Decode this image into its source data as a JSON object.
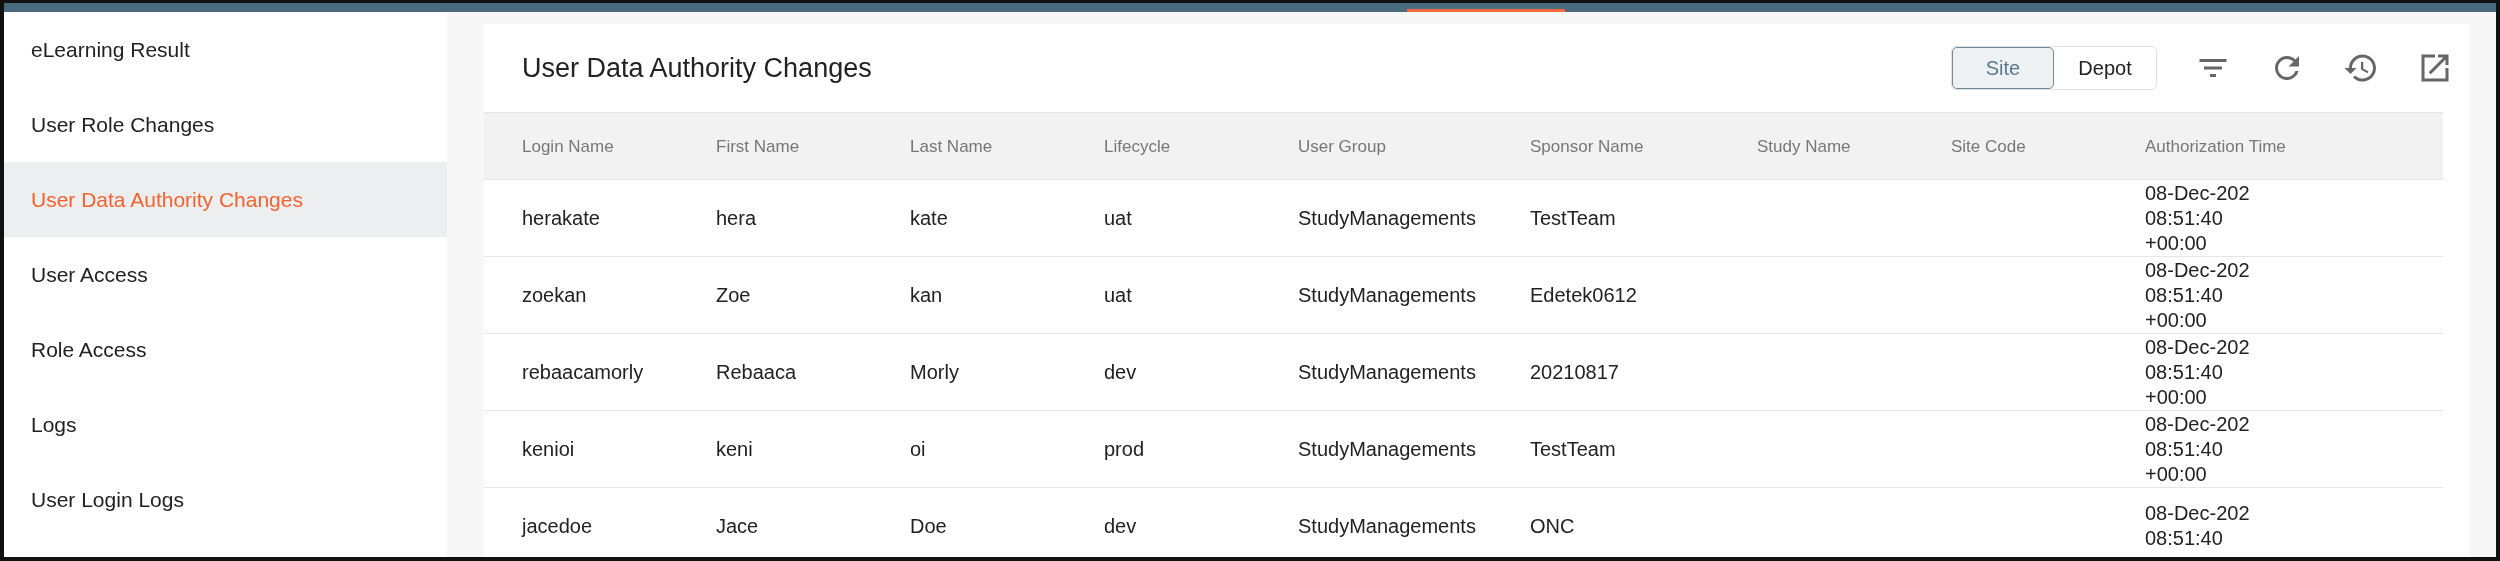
{
  "sidebar": {
    "items": [
      {
        "label": "eLearning Result",
        "selected": false
      },
      {
        "label": "User Role Changes",
        "selected": false
      },
      {
        "label": "User Data Authority Changes",
        "selected": true
      },
      {
        "label": "User Access",
        "selected": false
      },
      {
        "label": "Role Access",
        "selected": false
      },
      {
        "label": "Logs",
        "selected": false
      },
      {
        "label": "User Login Logs",
        "selected": false
      }
    ]
  },
  "panel": {
    "title": "User Data Authority Changes",
    "toggle": [
      {
        "label": "Site",
        "selected": true
      },
      {
        "label": "Depot",
        "selected": false
      }
    ],
    "table": {
      "columns": [
        "Login Name",
        "First Name",
        "Last Name",
        "Lifecycle",
        "User Group",
        "Sponsor Name",
        "Study Name",
        "Site Code",
        "Authorization Time"
      ],
      "rows": [
        {
          "cells": [
            "herakate",
            "hera",
            "kate",
            "uat",
            "StudyManagements",
            "TestTeam",
            "",
            ""
          ],
          "time": [
            "08-Dec-202",
            "08:51:40",
            "+00:00"
          ]
        },
        {
          "cells": [
            "zoekan",
            "Zoe",
            "kan",
            "uat",
            "StudyManagements",
            "Edetek0612",
            "",
            ""
          ],
          "time": [
            "08-Dec-202",
            "08:51:40",
            "+00:00"
          ]
        },
        {
          "cells": [
            "rebaacamorly",
            "Rebaaca",
            "Morly",
            "dev",
            "StudyManagements",
            "20210817",
            "",
            ""
          ],
          "time": [
            "08-Dec-202",
            "08:51:40",
            "+00:00"
          ]
        },
        {
          "cells": [
            "kenioi",
            "keni",
            "oi",
            "prod",
            "StudyManagements",
            "TestTeam",
            "",
            ""
          ],
          "time": [
            "08-Dec-202",
            "08:51:40",
            "+00:00"
          ]
        },
        {
          "cells": [
            "jacedoe",
            "Jace",
            "Doe",
            "dev",
            "StudyManagements",
            "ONC",
            "",
            ""
          ],
          "time": [
            "08-Dec-202",
            "08:51:40"
          ]
        }
      ]
    }
  }
}
